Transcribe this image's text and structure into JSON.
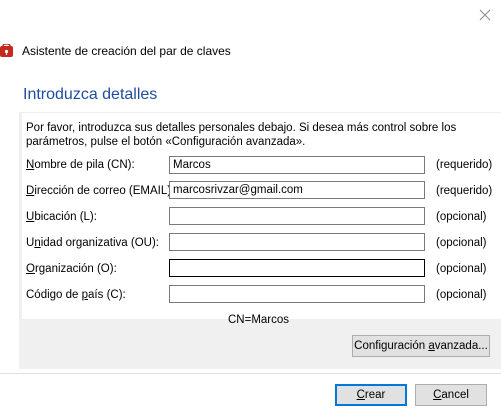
{
  "window": {
    "title": "Asistente de creación del par de claves"
  },
  "heading": "Introduzca detalles",
  "description": "Por favor, introduzca sus detalles personales debajo. Si desea más control sobre los parámetros, pulse el botón «Configuración avanzada».",
  "fields": [
    {
      "label_prefix": "",
      "label_accel": "N",
      "label_suffix": "ombre de pila (CN):",
      "value": "Marcos",
      "status": "(requerido)"
    },
    {
      "label_prefix": "",
      "label_accel": "D",
      "label_suffix": "irección de correo (EMAIL):",
      "value": "marcosrivzar@gmail.com",
      "status": "(requerido)"
    },
    {
      "label_prefix": "",
      "label_accel": "U",
      "label_suffix": "bicación (L):",
      "value": "",
      "status": "(opcional)"
    },
    {
      "label_prefix": "U",
      "label_accel": "n",
      "label_suffix": "idad organizativa (OU):",
      "value": "",
      "status": "(opcional)"
    },
    {
      "label_prefix": "",
      "label_accel": "O",
      "label_suffix": "rganización (O):",
      "value": "",
      "status": "(opcional)"
    },
    {
      "label_prefix": "Código de ",
      "label_accel": "p",
      "label_suffix": "aís (C):",
      "value": "",
      "status": "(opcional)"
    }
  ],
  "cn_preview": "CN=Marcos",
  "buttons": {
    "advanced_prefix": "Configuración ",
    "advanced_accel": "a",
    "advanced_suffix": "vanzada...",
    "create_prefix": "",
    "create_accel": "C",
    "create_suffix": "rear",
    "cancel_prefix": "",
    "cancel_accel": "C",
    "cancel_suffix": "ancel"
  },
  "icons": {
    "close": "close-icon",
    "app": "key-pair-app-icon"
  },
  "colors": {
    "heading": "#1f4d9c",
    "panel": "#f0f0f0",
    "default_button_border": "#0078d7",
    "app_icon": "#c42b1c"
  }
}
